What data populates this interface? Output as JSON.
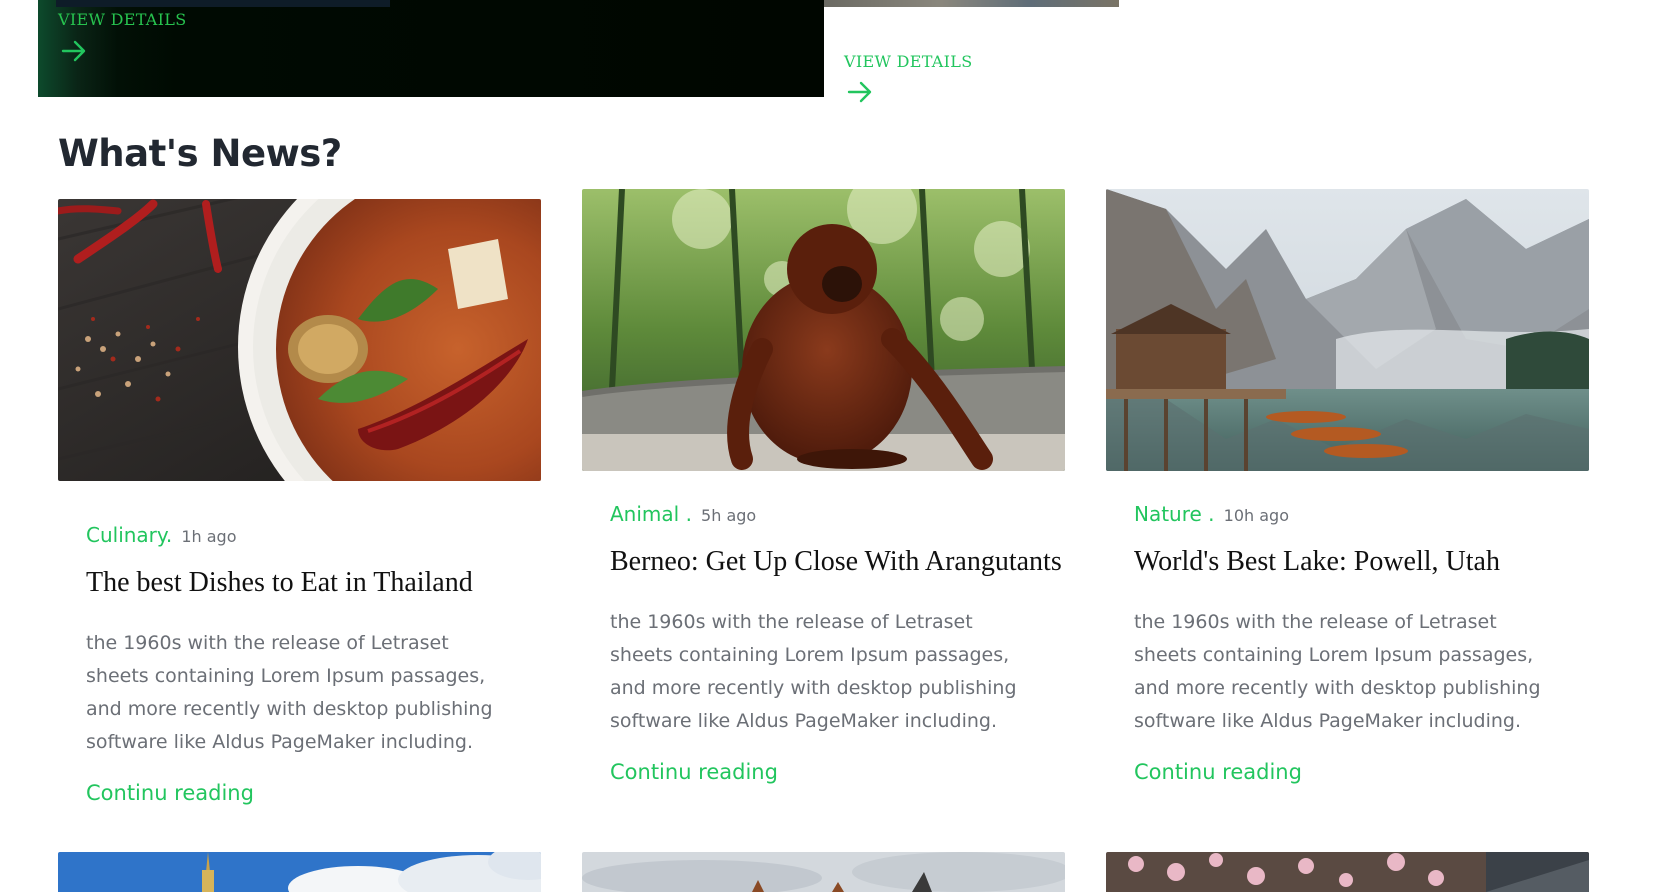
{
  "hero": {
    "left_link": "VIEW DETAILS",
    "right_link": "VIEW DETAILS"
  },
  "section": {
    "title": "What's News?"
  },
  "cards": [
    {
      "image": "thai-curry-bowl-photo",
      "category": "Culinary.",
      "time": "1h ago",
      "title": "The best Dishes to Eat in Thailand",
      "excerpt": "the 1960s with the release of Letraset sheets containing Lorem Ipsum passages, and more recently with desktop publishing software like Aldus PageMaker including.",
      "read_more": "Continu reading"
    },
    {
      "image": "orangutan-photo",
      "category": "Animal .",
      "time": "5h ago",
      "title": "Berneo: Get Up Close With Arangutants",
      "excerpt": "the 1960s with the release of Letraset sheets containing Lorem Ipsum passages, and more recently with desktop publishing software like Aldus PageMaker including.",
      "read_more": "Continu reading"
    },
    {
      "image": "mountain-lake-photo",
      "category": "Nature .",
      "time": "10h ago",
      "title": "World's Best Lake: Powell, Utah",
      "excerpt": "the 1960s with the release of Letraset sheets containing Lorem Ipsum passages, and more recently with desktop publishing software like Aldus PageMaker including.",
      "read_more": "Continu reading"
    }
  ],
  "colors": {
    "accent": "#22c55e",
    "heading": "#222831",
    "body_text": "#6b6f76",
    "title_text": "#111111"
  }
}
